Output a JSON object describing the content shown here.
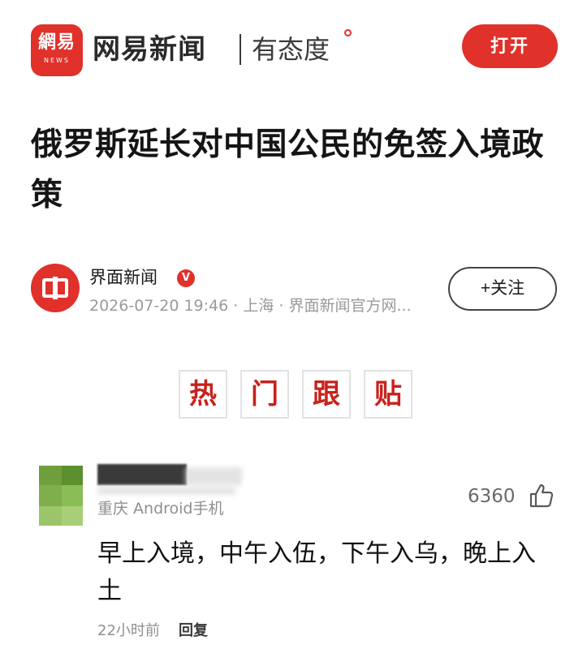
{
  "header": {
    "logo_glyph": "網易",
    "logo_sub": "NEWS",
    "brand_name": "网易新闻",
    "slogan": "有态度",
    "open_button_label": "打开",
    "accent_color": "#e0312b"
  },
  "article": {
    "title": "俄罗斯延长对中国公民的免签入境政策"
  },
  "source": {
    "name": "界面新闻",
    "verified_icon": "verified-v-icon",
    "meta": "2026-07-20 19:46 · 上海 · 界面新闻官方网...",
    "follow_button_label": "+关注"
  },
  "hot_comments": {
    "banner_chars": [
      "热",
      "门",
      "跟",
      "贴"
    ]
  },
  "comment": {
    "location": "重庆 Android手机",
    "like_count": "6360",
    "text": "早上入境，中午入伍，下午入乌，晚上入土",
    "time": "22小时前",
    "reply_label": "回复"
  }
}
